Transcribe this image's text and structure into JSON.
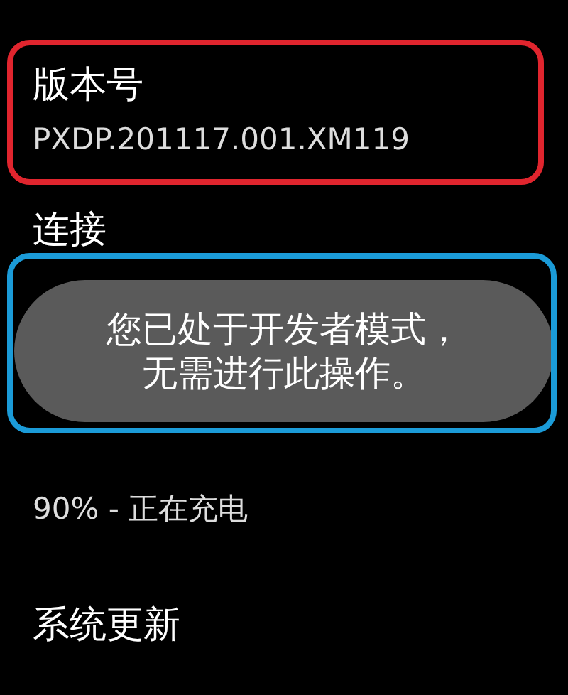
{
  "items": [
    {
      "title": "版本号",
      "summary": "PXDP.201117.001.XM119",
      "color": "#e0252e"
    },
    {
      "title": "连接"
    },
    {
      "summary": "90% - 正在充电"
    },
    {
      "title": "系统更新"
    }
  ],
  "toast": {
    "message": "您已处于开发者模式，无需进行此操作。",
    "color": "#1b9bd8"
  }
}
